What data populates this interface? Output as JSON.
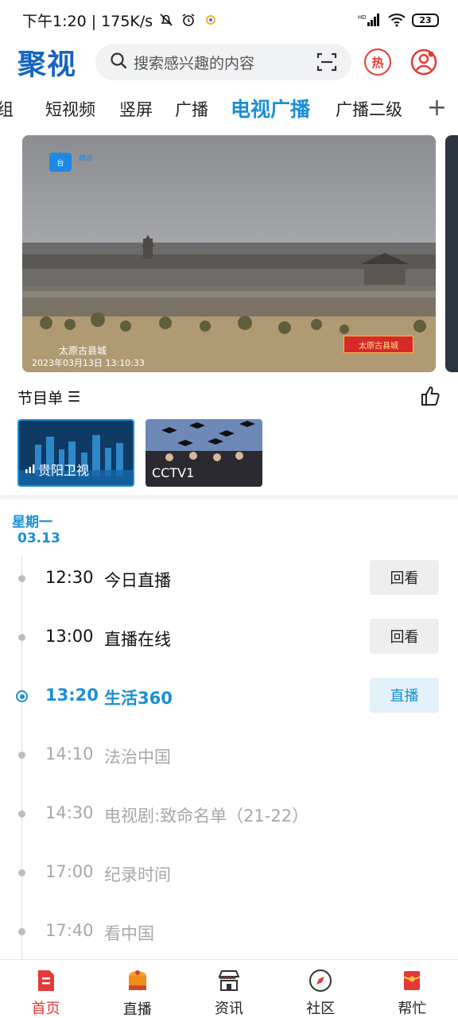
{
  "status_bar": {
    "time_speed": "下午1:20 | 175K/s",
    "network": "HD",
    "battery": "23"
  },
  "header": {
    "logo": "聚视",
    "search_placeholder": "搜索感兴趣的内容",
    "hot_label": "热"
  },
  "tabs": [
    {
      "label": "组"
    },
    {
      "label": "短视频"
    },
    {
      "label": "竖屏"
    },
    {
      "label": "广播"
    },
    {
      "label": "电视广播",
      "active": true
    },
    {
      "label": "广播二级"
    }
  ],
  "tabs_add": "+",
  "video": {
    "location_caption": "太原古县城",
    "timestamp": "2023年03月13日 13:10:33",
    "corner_tag": "太原古县城",
    "watermark": "精选"
  },
  "program_list": {
    "title": "节目单",
    "menu_glyph": "☰"
  },
  "channels": [
    {
      "name": "贵阳卫视",
      "selected": true
    },
    {
      "name": "CCTV1",
      "selected": false
    }
  ],
  "schedule": {
    "day": "星期一",
    "date": "03.13",
    "items": [
      {
        "time": "12:30",
        "title": "今日直播",
        "state": "past",
        "button": "回看"
      },
      {
        "time": "13:00",
        "title": "直播在线",
        "state": "past",
        "button": "回看"
      },
      {
        "time": "13:20",
        "title": "生活360",
        "state": "live",
        "button": "直播"
      },
      {
        "time": "14:10",
        "title": "法治中国",
        "state": "future",
        "button": ""
      },
      {
        "time": "14:30",
        "title": "电视剧:致命名单（21-22）",
        "state": "future",
        "button": ""
      },
      {
        "time": "17:00",
        "title": "纪录时间",
        "state": "future",
        "button": ""
      },
      {
        "time": "17:40",
        "title": "看中国",
        "state": "future",
        "button": ""
      }
    ]
  },
  "bottom_nav": [
    {
      "label": "首页",
      "active": true,
      "icon": "home-doc-icon"
    },
    {
      "label": "直播",
      "active": false,
      "icon": "live-cake-icon"
    },
    {
      "label": "资讯",
      "active": false,
      "icon": "store-icon"
    },
    {
      "label": "社区",
      "active": false,
      "icon": "compass-icon"
    },
    {
      "label": "帮忙",
      "active": false,
      "icon": "red-envelope-icon"
    }
  ],
  "colors": {
    "accent": "#1a8fd6",
    "brand": "#1565c0",
    "hot": "#e53935"
  }
}
